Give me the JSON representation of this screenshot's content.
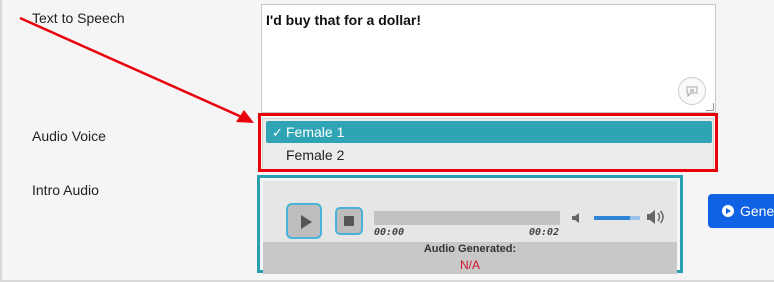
{
  "form": {
    "tts_label": "Text to Speech",
    "tts_value": "I'd buy that for a dollar!",
    "voice_label": "Audio Voice",
    "voice_options": [
      {
        "label": "Female 1",
        "selected": true
      },
      {
        "label": "Female 2",
        "selected": false
      }
    ],
    "intro_label": "Intro Audio"
  },
  "player": {
    "current_time": "00:00",
    "duration": "00:02",
    "status_title": "Audio Generated:",
    "status_value": "N/A"
  },
  "generate_button": {
    "label": "Gene"
  },
  "colors": {
    "highlight": "#e8000b",
    "selected_option": "#2ea4b4",
    "player_border": "#2a9fb0",
    "button": "#0f62e3",
    "status_value": "#d0112b"
  },
  "icons": {
    "play": "play-icon",
    "stop": "stop-icon",
    "volume_low": "volume-low-icon",
    "volume_high": "volume-high-icon",
    "clear": "clear-icon",
    "generate": "play-circle-icon",
    "checkmark": "checkmark-icon"
  }
}
